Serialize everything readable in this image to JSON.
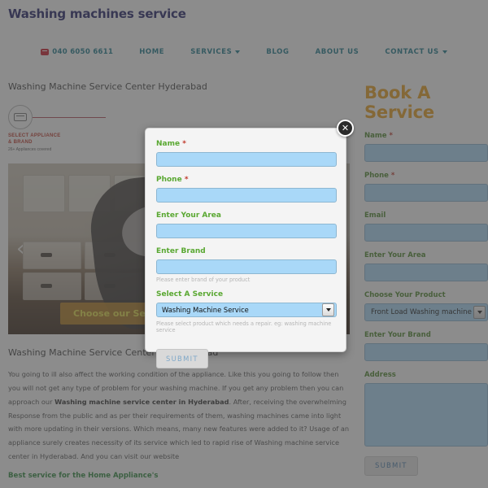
{
  "header": {
    "logo": "Washing machines service",
    "nav": [
      {
        "label": "040 6050 6611",
        "icon": "telephone-icon",
        "has_caret": false
      },
      {
        "label": "HOME",
        "has_caret": false
      },
      {
        "label": "SERVICES",
        "has_caret": true
      },
      {
        "label": "BLOG",
        "has_caret": false
      },
      {
        "label": "ABOUT US",
        "has_caret": false
      },
      {
        "label": "CONTACT US",
        "has_caret": true
      }
    ]
  },
  "main": {
    "page_title": "Washing Machine Service Center Hyderabad",
    "step": {
      "title": "SELECT APPLIANCE\n& BRAND",
      "subtitle": "26+ Appliances covered"
    },
    "carousel": {
      "cta": "Choose our Service",
      "prev": "‹",
      "next": "›"
    },
    "section_heading": "Washing Machine Service Center in Hyderabad",
    "paragraph_1": "You going to ill also affect the working condition of the appliance. Like this you going to follow then you will not get any type of problem for your washing machine. If you get any problem then you can approach our ",
    "paragraph_bold": "Washing machine service center in Hyderabad",
    "paragraph_2": ". After, receiving the overwhelming Response from the public and as per their requirements of them, washing machines came into light with more updating in their versions. Which means, many new features were added to it? Usage of an appliance surely creates necessity of its service which led to rapid rise of Washing machine service center in Hyderabad.  And you can visit our website",
    "green_heading": "Best service for the Home Appliance's"
  },
  "sidebar": {
    "title": "Book A Service",
    "fields": [
      {
        "label": "Name",
        "required": true,
        "value": "",
        "type": "text"
      },
      {
        "label": "Phone",
        "required": true,
        "value": "",
        "type": "text"
      },
      {
        "label": "Email",
        "required": false,
        "value": "",
        "type": "text"
      },
      {
        "label": "Enter Your Area",
        "required": false,
        "value": "",
        "type": "text"
      },
      {
        "label": "Choose Your Product",
        "required": false,
        "value": "Front Load Washing machine",
        "type": "select"
      },
      {
        "label": "Enter Your Brand",
        "required": false,
        "value": "",
        "type": "text"
      },
      {
        "label": "Address",
        "required": false,
        "value": "",
        "type": "textarea"
      }
    ],
    "submit_label": "SUBMIT"
  },
  "modal": {
    "close_label": "✕",
    "fields": [
      {
        "label": "Name",
        "required": true,
        "value": "",
        "type": "text",
        "hint": ""
      },
      {
        "label": "Phone",
        "required": true,
        "value": "",
        "type": "text",
        "hint": ""
      },
      {
        "label": "Enter Your Area",
        "required": false,
        "value": "",
        "type": "text",
        "hint": ""
      },
      {
        "label": "Enter Brand",
        "required": false,
        "value": "",
        "type": "text",
        "hint": "Please enter brand of your product"
      },
      {
        "label": "Select A Service",
        "required": false,
        "value": "Washing Machine Service",
        "type": "select",
        "hint": "Please select product which needs a repair. eg: washing machine service"
      }
    ],
    "submit_label": "SUBMIT"
  },
  "colors": {
    "logo": "#23226b",
    "nav_link": "#1d7b8f",
    "phone_icon": "#cc1f2e",
    "sidebar_title": "#e9a020",
    "field_label_green": "#4f8a2e",
    "modal_label_green": "#5aa832",
    "required_star": "#c0392b",
    "input_fill": "#aedcfb",
    "cta_text": "#e8e24a"
  }
}
